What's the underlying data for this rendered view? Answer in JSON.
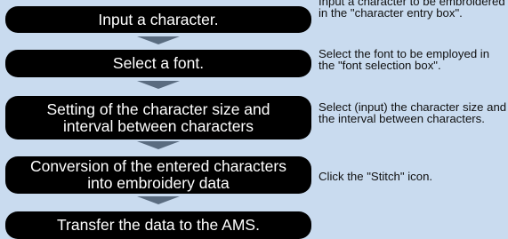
{
  "steps": [
    {
      "label": "Input a character."
    },
    {
      "label": "Select a font."
    },
    {
      "label": "Setting of the character size and interval between characters"
    },
    {
      "label": "Conversion of the entered characters into embroidery data"
    },
    {
      "label": "Transfer the data to the AMS."
    }
  ],
  "notes": [
    {
      "text": "Input a character to be embroidered in the \"character entry box\"."
    },
    {
      "text": "Select the font to be employed in the \"font selection box\"."
    },
    {
      "text": "Select (input) the character size and the interval between characters."
    },
    {
      "text": "Click the \"Stitch\" icon."
    }
  ],
  "colors": {
    "background": "#c9dbef",
    "step_box": "#000000",
    "step_text": "#ffffff",
    "arrow": "#5a6c80"
  }
}
